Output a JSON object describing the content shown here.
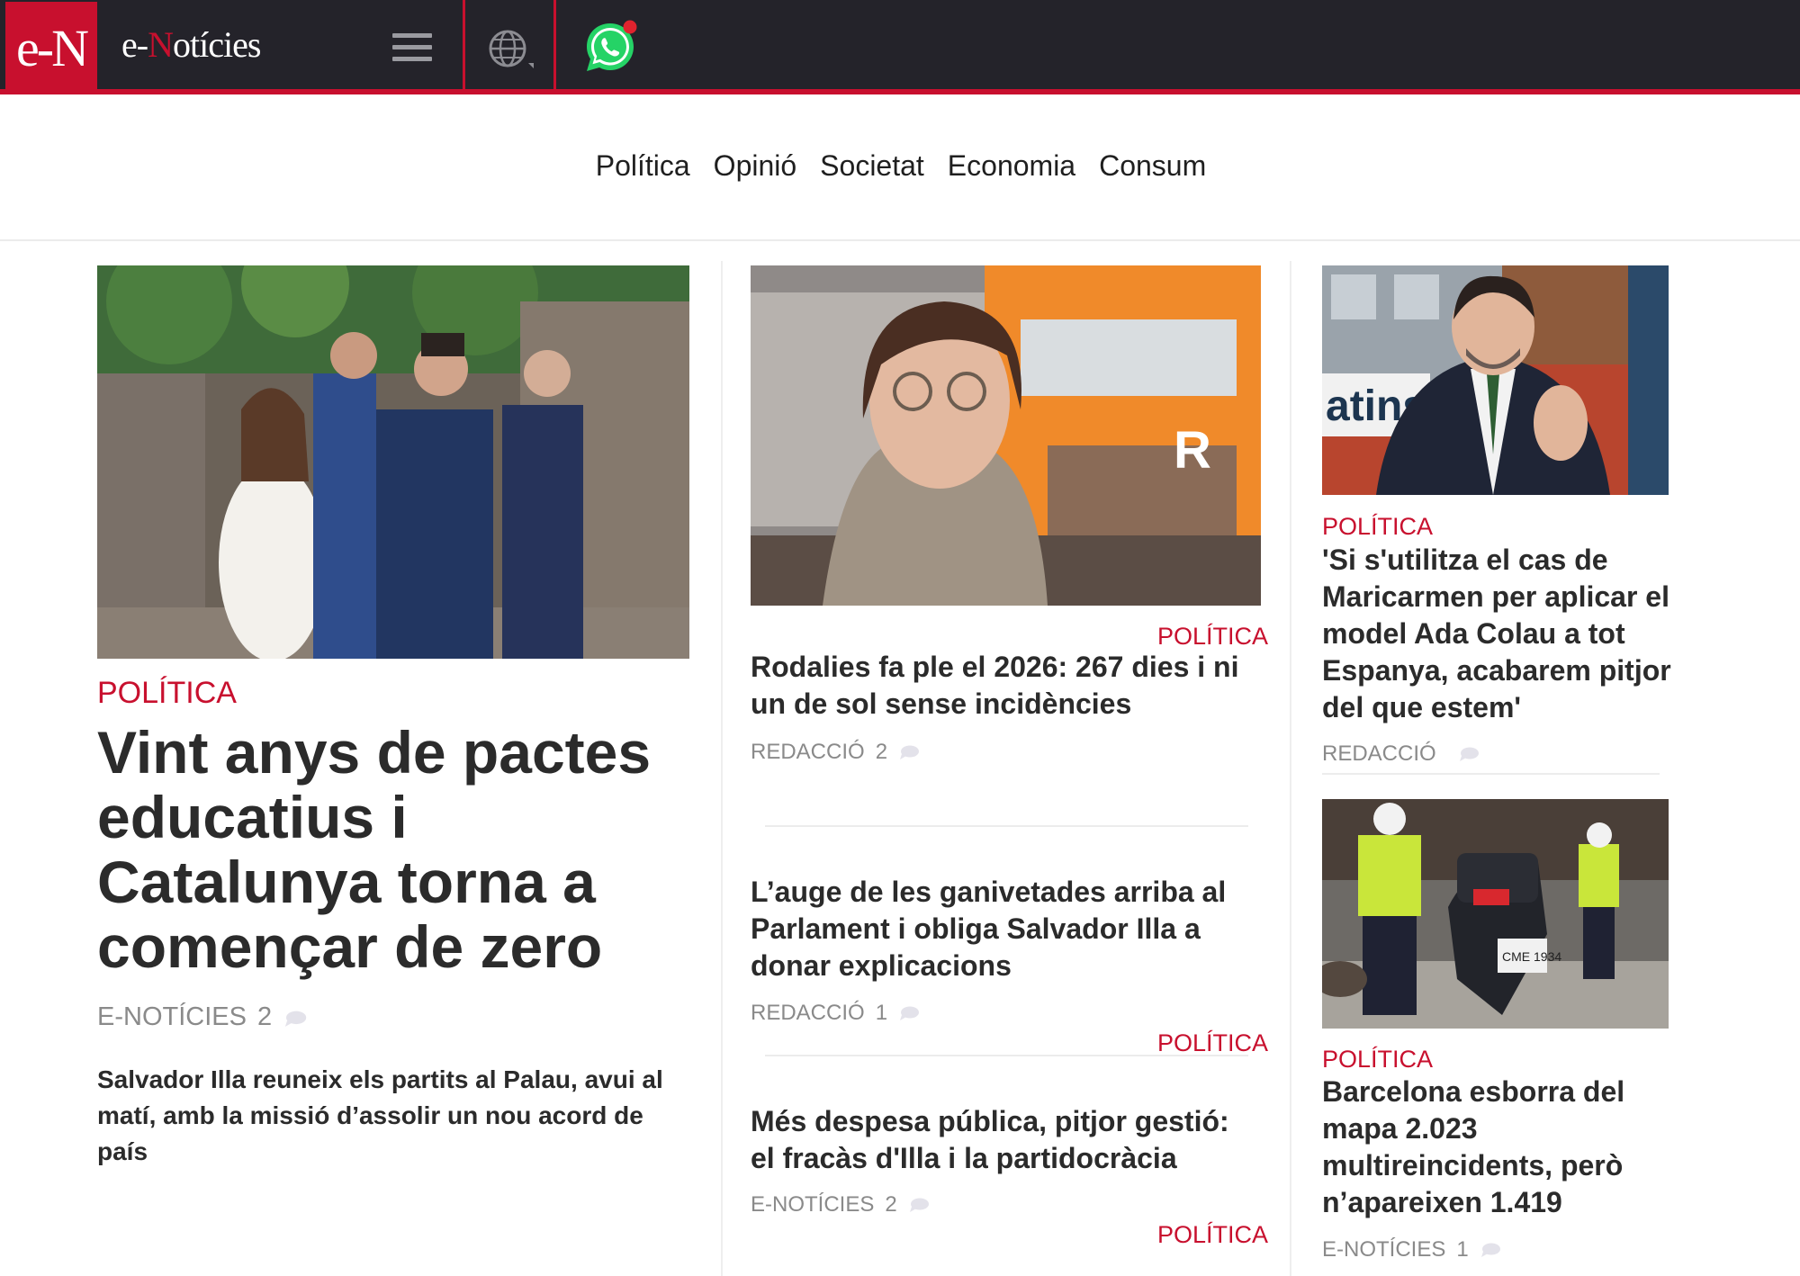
{
  "brand": {
    "logo_text": "e-N",
    "name_prefix": "e-",
    "name_n": "N",
    "name_rest": "otícies"
  },
  "icons": {
    "menu": "hamburger-menu-icon",
    "language": "globe-icon",
    "whatsapp": "whatsapp-icon",
    "comment": "comment-bubble-icon"
  },
  "colors": {
    "brand_red": "#c8102e",
    "topbar": "#24232a"
  },
  "nav": {
    "items": [
      "Política",
      "Opinió",
      "Societat",
      "Economia",
      "Consum"
    ]
  },
  "articles": {
    "lead": {
      "category": "POLÍTICA",
      "headline": "Vint anys de pactes educatius i Catalunya torna a començar de zero",
      "author": "E-NOTÍCIES",
      "comments": "2",
      "summary": "Salvador Illa reuneix els partits al Palau, avui al matí, amb la missió d’assolir un nou acord de país"
    },
    "center": [
      {
        "category": "POLÍTICA",
        "headline": "Rodalies fa ple el 2026: 267 dies i ni un de sol sense incidències",
        "author": "REDACCIÓ",
        "comments": "2"
      },
      {
        "headline": "L’auge de les ganivetades arriba al Parlament i obliga Salvador Illa a donar explicacions",
        "author": "REDACCIÓ",
        "comments": "1",
        "category": "POLÍTICA"
      },
      {
        "headline": "Més despesa pública, pitjor gestió: el fracàs d'Illa i la partidocràcia",
        "author": "E-NOTÍCIES",
        "comments": "2",
        "category": "POLÍTICA"
      }
    ],
    "right": [
      {
        "category": "POLÍTICA",
        "headline": "'Si s'utilitza el cas de Maricarmen per aplicar el model Ada Colau a tot Espanya, acabarem pitjor del que estem'",
        "author": "REDACCIÓ",
        "comments": ""
      },
      {
        "category": "POLÍTICA",
        "headline": "Barcelona esborra del mapa 2.023 multireincidents, però n’apareixen 1.419",
        "author": "E-NOTÍCIES",
        "comments": "1"
      }
    ]
  }
}
